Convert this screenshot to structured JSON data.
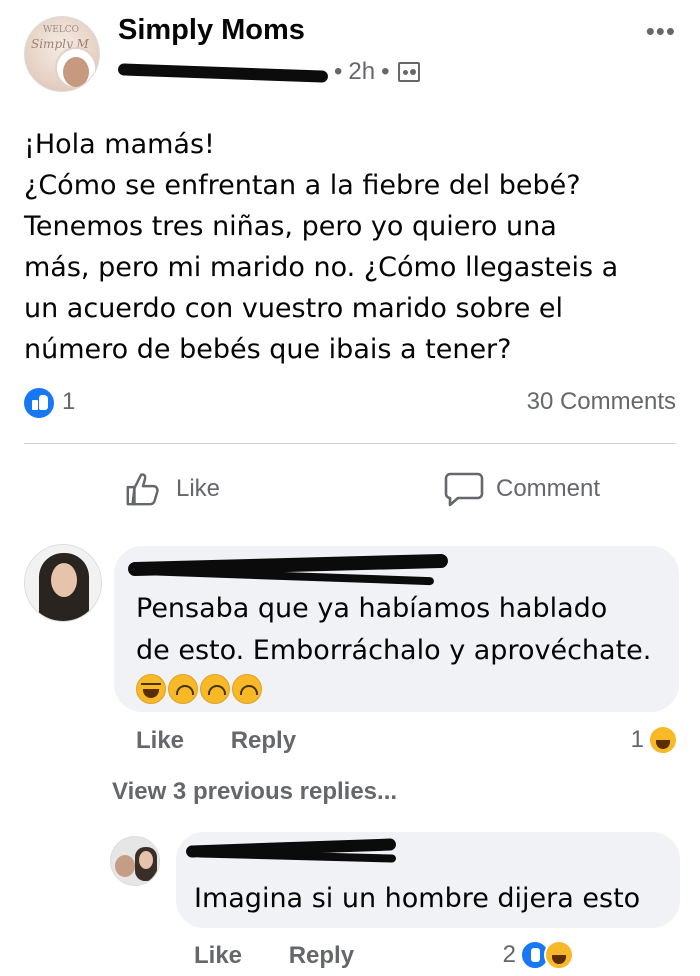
{
  "post": {
    "group_name": "Simply Moms",
    "group_avatar_text": "WELCO",
    "group_avatar_script": "Simply M",
    "timestamp": "2h",
    "separator": "•",
    "text_lines": [
      "¡Hola mamás!",
      "¿Cómo se enfrentan a la fiebre del bebé?",
      "Tenemos tres niñas, pero yo quiero una",
      "más, pero mi marido no. ¿Cómo llegasteis a",
      "un acuerdo con vuestro marido sobre el",
      "número de bebés que ibais a tener?"
    ],
    "reaction_count": "1",
    "comments_count": "30 Comments",
    "like_label": "Like",
    "comment_label": "Comment"
  },
  "comments": [
    {
      "text_lines": [
        "Pensaba que ya habíamos hablado",
        "de esto. Emborráchalo y aprovéchate."
      ],
      "emojis": [
        "rolling-laughing",
        "upside-down",
        "upside-down",
        "upside-down"
      ],
      "like_label": "Like",
      "reply_label": "Reply",
      "reaction_count": "1"
    },
    {
      "text": "Imagina si un hombre dijera esto",
      "like_label": "Like",
      "reply_label": "Reply",
      "reaction_count": "2"
    }
  ],
  "view_previous_replies": "View 3 previous replies...",
  "colors": {
    "facebook_blue": "#1877f2",
    "secondary_text": "#65676b",
    "bubble_bg": "#f0f2f5",
    "emoji_yellow": "#f7b928"
  }
}
